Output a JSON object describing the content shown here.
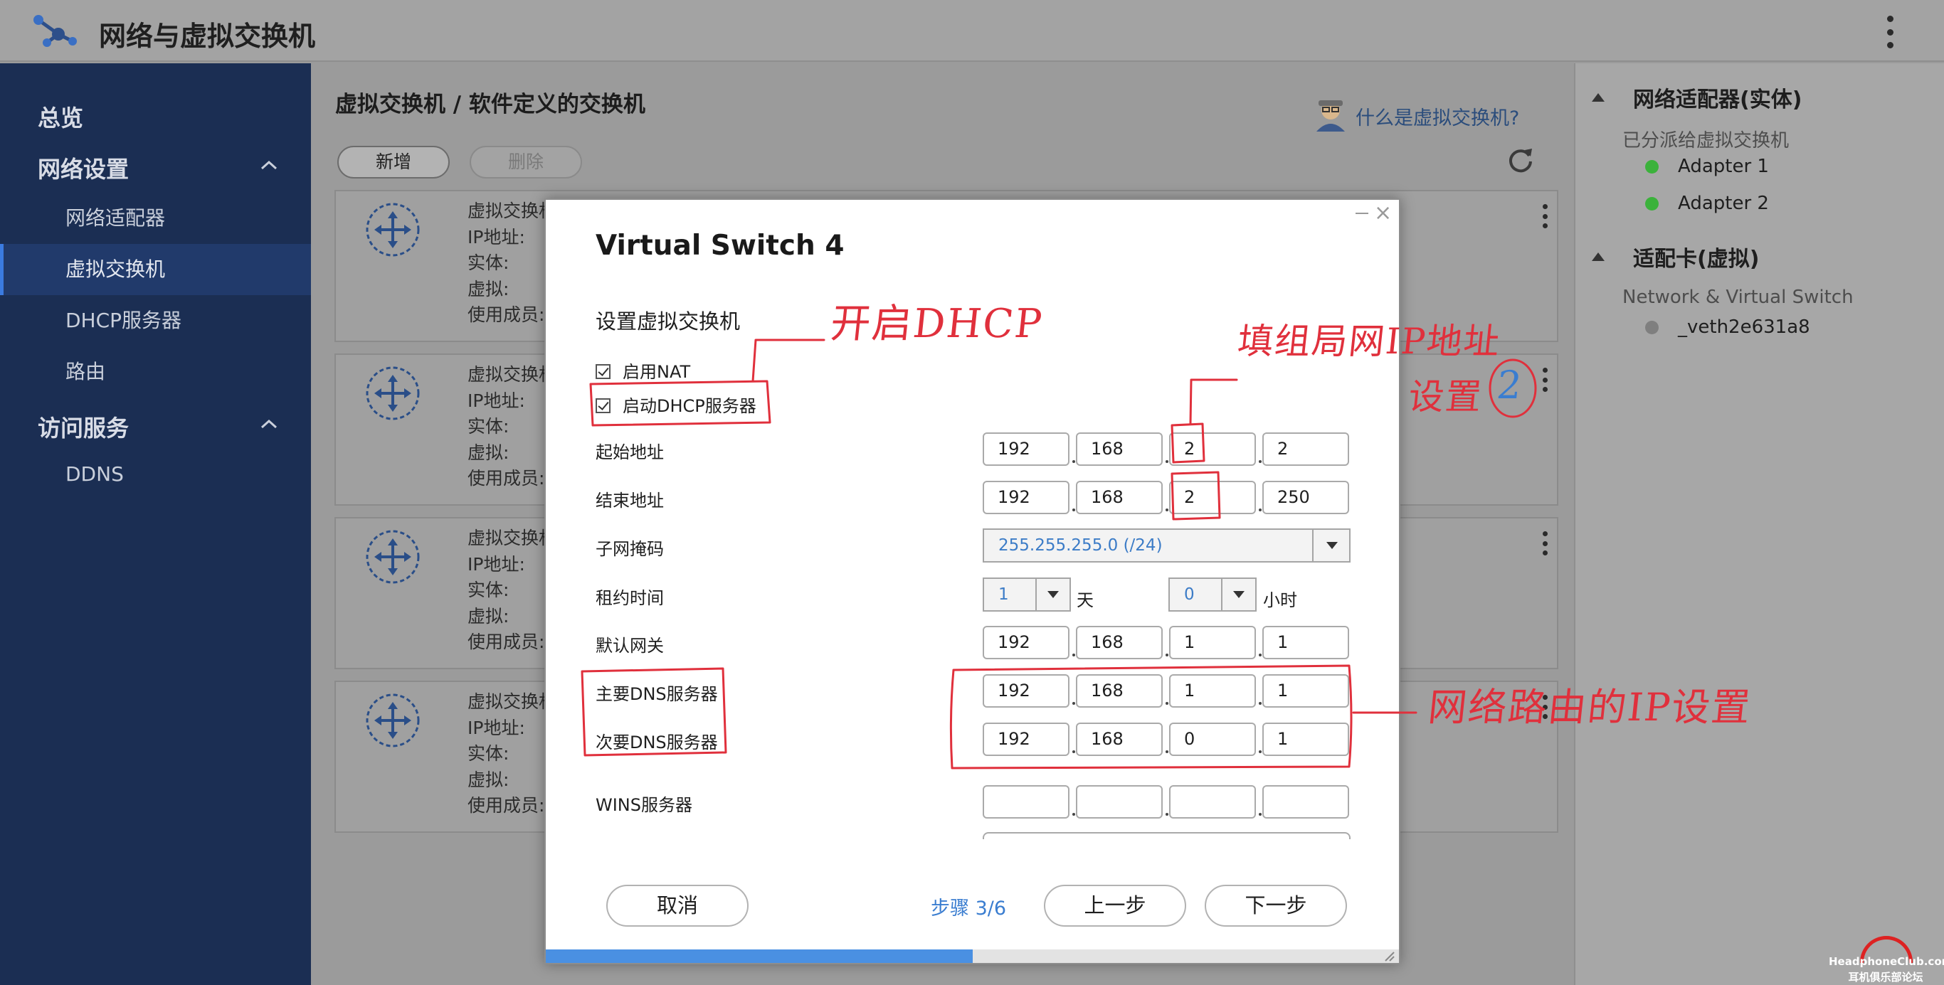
{
  "app": {
    "title": "网络与虚拟交换机",
    "logo_icon": "network-switch-icon"
  },
  "sidebar": {
    "overview": "总览",
    "groups": [
      {
        "label": "网络设置",
        "items": [
          "网络适配器",
          "虚拟交换机",
          "DHCP服务器",
          "路由"
        ]
      },
      {
        "label": "访问服务",
        "items": [
          "DDNS"
        ]
      }
    ],
    "active_item": "虚拟交换机"
  },
  "main": {
    "title": "虚拟交换机 / 软件定义的交换机",
    "help_link": "什么是虚拟交换机?",
    "add_button": "新增",
    "delete_button": "删除",
    "card_fields": [
      "虚拟交换机:",
      "IP地址:",
      "实体:",
      "虚拟:",
      "使用成员:"
    ]
  },
  "right_panel": {
    "physical": {
      "heading": "网络适配器(实体)",
      "sub": "已分派给虚拟交换机",
      "items": [
        {
          "name": "Adapter 1",
          "status": "green"
        },
        {
          "name": "Adapter 2",
          "status": "green"
        }
      ]
    },
    "virtual": {
      "heading": "适配卡(虚拟)",
      "sub": "Network & Virtual Switch",
      "items": [
        {
          "name": "_veth2e631a8",
          "status": "gray"
        }
      ]
    }
  },
  "dialog": {
    "title": "Virtual Switch 4",
    "section": "设置虚拟交换机",
    "enable_nat": {
      "label": "启用NAT",
      "checked": true
    },
    "enable_dhcp": {
      "label": "启动DHCP服务器",
      "checked": true
    },
    "start_address": {
      "label": "起始地址",
      "octets": [
        "192",
        "168",
        "2",
        "2"
      ]
    },
    "end_address": {
      "label": "结束地址",
      "octets": [
        "192",
        "168",
        "2",
        "250"
      ]
    },
    "subnet_mask": {
      "label": "子网掩码",
      "value": "255.255.255.0 (/24)"
    },
    "lease_time": {
      "label": "租约时间",
      "days": "1",
      "days_unit": "天",
      "hours": "0",
      "hours_unit": "小时"
    },
    "default_gateway": {
      "label": "默认网关",
      "octets": [
        "192",
        "168",
        "1",
        "1"
      ]
    },
    "primary_dns": {
      "label": "主要DNS服务器",
      "octets": [
        "192",
        "168",
        "1",
        "1"
      ]
    },
    "secondary_dns": {
      "label": "次要DNS服务器",
      "octets": [
        "192",
        "168",
        "0",
        "1"
      ]
    },
    "wins": {
      "label": "WINS服务器",
      "octets": [
        "",
        "",
        "",
        ""
      ]
    },
    "cancel_button": "取消",
    "step": "步骤 3/6",
    "progress": 0.5,
    "prev_button": "上一步",
    "next_button": "下一步"
  },
  "annotations": {
    "dhcp_note": "开启DHCP",
    "subnet_note_line1": "填组局网IP地址",
    "subnet_note_line2": "设置",
    "subnet_note_circled": "2",
    "dns_note": "网络路由的IP设置"
  },
  "watermark": {
    "top": "HeadphoneClub.com",
    "bottom": "耳机俱乐部论坛"
  },
  "colors": {
    "sidebar_bg": "#1b2e53",
    "accent_blue": "#4a90e2",
    "annotation_red": "#e0303c",
    "status_green": "#3bb23b"
  }
}
